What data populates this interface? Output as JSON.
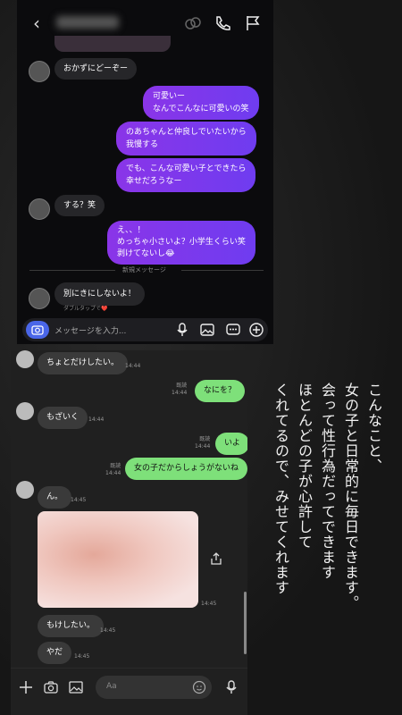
{
  "instagram": {
    "input_placeholder": "メッセージを入力...",
    "new_messages": "新規メッセージ",
    "double_tap_hint": "ダブルタップで❤️",
    "messages": [
      {
        "dir": "in",
        "text": "おかずにどーぞー"
      },
      {
        "dir": "out",
        "text": "可愛いー\nなんでこんなに可愛いの笑"
      },
      {
        "dir": "out",
        "text": "のあちゃんと仲良しでいたいから\n我慢する"
      },
      {
        "dir": "out",
        "text": "でも、こんな可愛い子とできたら\n幸せだろうなー"
      },
      {
        "dir": "in",
        "text": "する？笑"
      },
      {
        "dir": "out",
        "text": "え、、！\nめっちゃ小さいよ？小学生くらい笑\n剥けてないし😂"
      },
      {
        "dir": "in",
        "text": "別にきにしないよ！"
      }
    ]
  },
  "line": {
    "input_placeholder": "Aa",
    "messages": [
      {
        "text": "ちょとだけしたい。",
        "time": "14:44"
      },
      {
        "text": "なにを？",
        "read": "既読",
        "time": "14:44"
      },
      {
        "text": "もざいく",
        "time": "14:44"
      },
      {
        "text": "いよ",
        "read": "既読",
        "time": "14:44"
      },
      {
        "text": "女の子だからしょうがないね",
        "read": "既読",
        "time": "14:44"
      },
      {
        "text": "ん。",
        "time": "14:45"
      },
      {
        "image": true,
        "time": "14:45"
      },
      {
        "text": "もけしたい。",
        "time": "14:45"
      },
      {
        "text": "やだ",
        "time": "14:45"
      }
    ]
  },
  "caption": {
    "lines": [
      "こんなこと、",
      "女の子と日常的に毎日できます。",
      "会って性行為だってできます",
      "ほとんどの子が心許して",
      "くれてるので、みせてくれます"
    ]
  },
  "colors": {
    "ig_gradient_start": "#8a35e8",
    "ig_gradient_end": "#6f3cf0",
    "line_green": "#7ee07a"
  }
}
